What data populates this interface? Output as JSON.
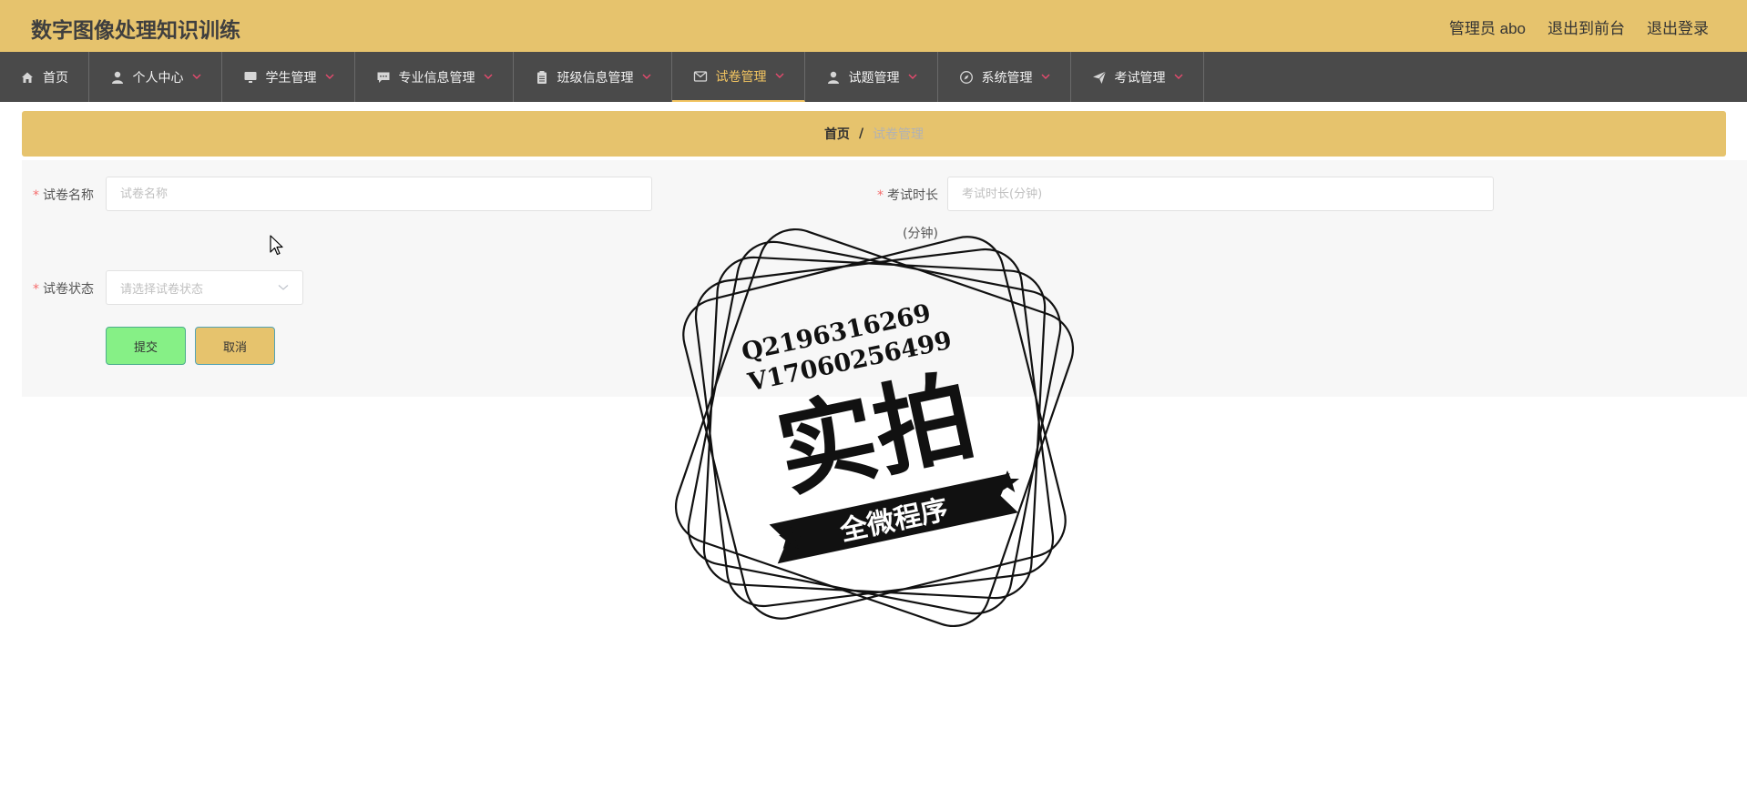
{
  "header": {
    "title": "数字图像处理知识训练",
    "links": [
      "管理员 abo",
      "退出到前台",
      "退出登录"
    ]
  },
  "nav": {
    "items": [
      {
        "label": "首页",
        "icon": "home-icon",
        "caret": false,
        "active": false
      },
      {
        "label": "个人中心",
        "icon": "user-icon",
        "caret": true,
        "active": false
      },
      {
        "label": "学生管理",
        "icon": "monitor-icon",
        "caret": true,
        "active": false
      },
      {
        "label": "专业信息管理",
        "icon": "chat-icon",
        "caret": true,
        "active": false
      },
      {
        "label": "班级信息管理",
        "icon": "clipboard-icon",
        "caret": true,
        "active": false
      },
      {
        "label": "试卷管理",
        "icon": "mail-icon",
        "caret": true,
        "active": true
      },
      {
        "label": "试题管理",
        "icon": "user-icon",
        "caret": true,
        "active": false
      },
      {
        "label": "系统管理",
        "icon": "compass-icon",
        "caret": true,
        "active": false
      },
      {
        "label": "考试管理",
        "icon": "send-icon",
        "caret": true,
        "active": false
      }
    ]
  },
  "breadcrumb": {
    "home": "首页",
    "separator": "/",
    "current": "试卷管理"
  },
  "form": {
    "paper_name": {
      "label": "试卷名称",
      "placeholder": "试卷名称",
      "value": ""
    },
    "duration": {
      "label": "考试时长",
      "label_suffix": "(分钟)",
      "placeholder": "考试时长(分钟)",
      "value": ""
    },
    "status": {
      "label": "试卷状态",
      "placeholder": "请选择试卷状态"
    },
    "submit_label": "提交",
    "cancel_label": "取消"
  },
  "watermark": {
    "line1": "Q2196316269",
    "line2": "V17060256499",
    "big": "实拍",
    "ribbon": "全微程序"
  },
  "colors": {
    "header_bg": "#e6c36d",
    "nav_bg": "#4a4a4a",
    "nav_active": "#f3c561",
    "submit_bg": "#86f086",
    "cancel_bg": "#e6c36d"
  }
}
